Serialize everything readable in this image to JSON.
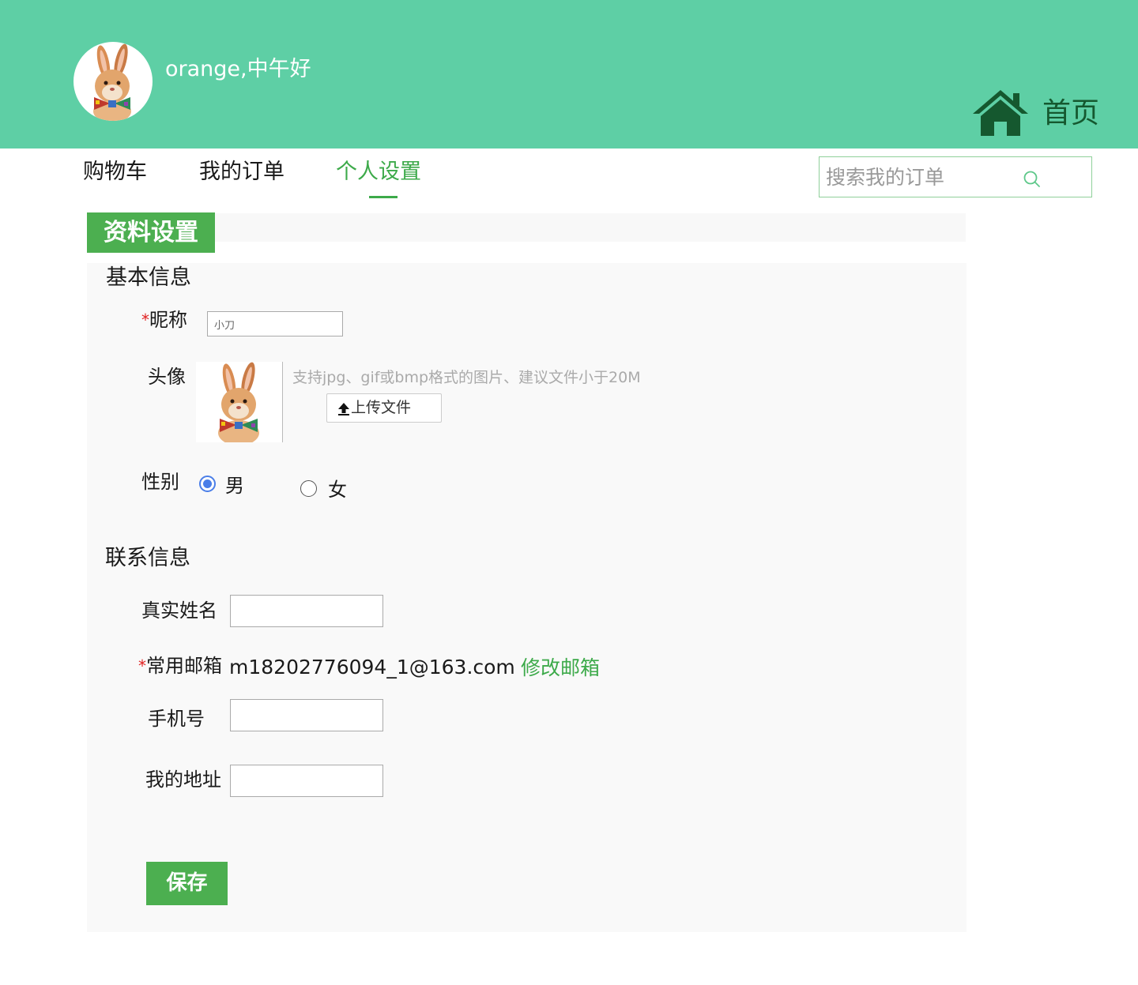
{
  "header": {
    "greeting": "orange,中午好",
    "home_label": "首页",
    "colors": {
      "background": "#5ecfa5",
      "home": "#15582f"
    }
  },
  "nav": {
    "items": [
      {
        "label": "购物车"
      },
      {
        "label": "我的订单"
      },
      {
        "label": "个人设置",
        "active": true
      }
    ],
    "accent": "#3daa4a"
  },
  "search": {
    "placeholder": "搜索我的订单",
    "value": ""
  },
  "section_tab": "资料设置",
  "basic": {
    "title": "基本信息",
    "nickname_label": "昵称",
    "nickname_value": "小刀",
    "avatar_label": "头像",
    "avatar_hint": "支持jpg、gif或bmp格式的图片、建议文件小于20M",
    "upload_label": "上传文件",
    "gender_label": "性别",
    "gender_options": [
      "男",
      "女"
    ],
    "gender_selected": "男"
  },
  "contact": {
    "title": "联系信息",
    "realname_label": "真实姓名",
    "realname_value": "",
    "email_label": "常用邮箱",
    "email_value": "m18202776094_1@163.com",
    "email_change": "修改邮箱",
    "phone_label": "手机号",
    "phone_value": "",
    "address_label": "我的地址",
    "address_value": ""
  },
  "required_mark": "*",
  "save_label": "保存",
  "icons": [
    "rabbit-avatar",
    "home-icon",
    "search-icon",
    "upload-icon"
  ]
}
